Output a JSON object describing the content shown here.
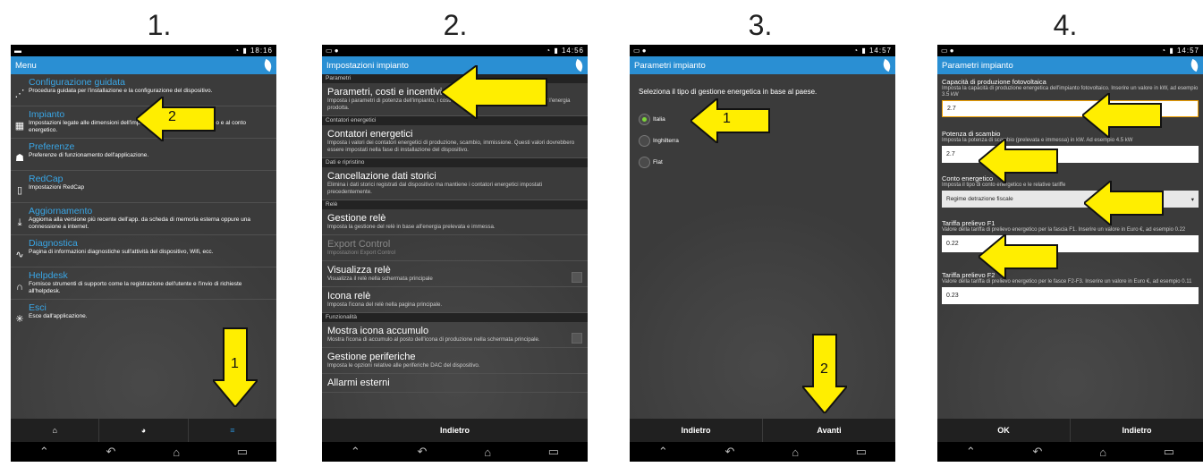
{
  "steps": [
    "1.",
    "2.",
    "3.",
    "4."
  ],
  "panel1": {
    "status_time": "18:16",
    "title": "Menu",
    "items": [
      {
        "title": "Configurazione guidata",
        "desc": "Procedura guidata per l'installazione e la configurazione del dispositivo."
      },
      {
        "title": "Impianto",
        "desc": "Impostazioni legate alle dimensioni dell'impianto di produzione e consumo e al conto energetico."
      },
      {
        "title": "Preferenze",
        "desc": "Preferenze di funzionamento dell'applicazione."
      },
      {
        "title": "RedCap",
        "desc": "Impostazioni RedCap"
      },
      {
        "title": "Aggiornamento",
        "desc": "Aggiorna alla versione più recente dell'app. da scheda di memoria esterna oppure una connessione a internet."
      },
      {
        "title": "Diagnostica",
        "desc": "Pagina di informazioni diagnostiche sull'attività del dispositivo, Wifi, ecc."
      },
      {
        "title": "Helpdesk",
        "desc": "Fornisce strumenti di supporto come la registrazione dell'utente e l'invio di richieste all'helpdesk."
      },
      {
        "title": "Esci",
        "desc": "Esce dall'applicazione."
      }
    ],
    "arrow_labels": [
      "2",
      "1"
    ]
  },
  "panel2": {
    "status_time": "14:56",
    "title": "Impostazioni impianto",
    "sections": [
      {
        "header": "Parametri",
        "items": [
          {
            "title": "Parametri, costi e incentivi",
            "desc": "Imposta i parametri di potenza dell'impianto, i costi dell'energia prelevata e gli incentivi per l'energia prodotta."
          }
        ]
      },
      {
        "header": "Contatori energetici",
        "items": [
          {
            "title": "Contatori energetici",
            "desc": "Imposta i valori dei contatori energetici di produzione, scambio, immissione. Questi valori dovrebbero essere impostati nella fase di installazione del dispositivo."
          }
        ]
      },
      {
        "header": "Dati e ripristino",
        "items": [
          {
            "title": "Cancellazione dati storici",
            "desc": "Elimina i dati storici registrati dal dispositivo ma mantiene i contatori energetici impostati precedentemente."
          }
        ]
      },
      {
        "header": "Relè",
        "items": [
          {
            "title": "Gestione relè",
            "desc": "Imposta la gestione del relè in base all'energia prelevata e immessa."
          },
          {
            "title": "Export Control",
            "desc": "Impostazioni Export Control"
          },
          {
            "title": "Visualizza relè",
            "desc": "Visualizza il relè nella schermata principale"
          },
          {
            "title": "Icona relè",
            "desc": "Imposta l'icona del relè nella pagina principale."
          }
        ]
      },
      {
        "header": "Funzionalità",
        "items": [
          {
            "title": "Mostra icona accumulo",
            "desc": "Mostra l'icona di accumulo al posto dell'icona di produzione nella schermata principale."
          },
          {
            "title": "Gestione periferiche",
            "desc": "Imposta le opzioni relative alle periferiche DAC del dispositivo."
          },
          {
            "title": "Allarmi esterni",
            "desc": ""
          }
        ]
      }
    ],
    "bottom_button": "Indietro"
  },
  "panel3": {
    "status_time": "14:57",
    "title": "Parametri impianto",
    "prompt": "Seleziona il tipo di gestione energetica in base al paese.",
    "options": [
      "Italia",
      "Inghilterra",
      "Flat"
    ],
    "selected_option": "Italia",
    "buttons": {
      "back": "Indietro",
      "next": "Avanti"
    },
    "arrow_labels": [
      "1",
      "2"
    ]
  },
  "panel4": {
    "status_time": "14:57",
    "title": "Parametri impianto",
    "fields": [
      {
        "label": "Capacità di produzione fotovoltaica",
        "hint": "Imposta la capacità di produzione energetica dell'impianto fotovoltaico. Inserire un valore in kW, ad esempio 3.5 kW",
        "value": "2.7"
      },
      {
        "label": "Potenza di scambio",
        "hint": "Imposta la potenza di scambio (prelevata e immessa) in kW. Ad esempio 4.5 kW",
        "value": "2.7"
      },
      {
        "label": "Conto energetico",
        "hint": "Imposta il tipo di conto energetico e le relative tariffe",
        "value": "Regime detrazione fiscale"
      },
      {
        "label": "Tariffa prelievo F1",
        "hint": "Valore della tariffa di prelievo energetico per la fascia F1. Inserire un valore in Euro €, ad esempio 0.22",
        "value": "0.22"
      },
      {
        "label": "Tariffa prelievo F2",
        "hint": "Valore della tariffa di prelievo energetico per le fasce F2-F3. Inserire un valore in Euro €, ad esempio 0.11",
        "value": "0.23"
      }
    ],
    "buttons": {
      "ok": "OK",
      "back": "Indietro"
    }
  },
  "colors": {
    "accent": "#2a8fd3",
    "arrow": "#ffee00",
    "menu_title": "#39a6e6"
  }
}
